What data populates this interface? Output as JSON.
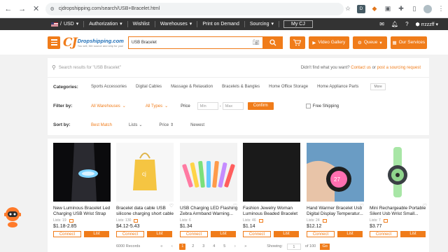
{
  "browser": {
    "url": "cjdropshipping.com/search/USB+Bracelet.html",
    "ext_badge": "D"
  },
  "topbar": {
    "currency": "USD",
    "items": [
      "Authorization",
      "Wishlist",
      "Warehouses",
      "Print on Demand",
      "Sourcing"
    ],
    "mycj": "My CJ",
    "username": "rrzzzff"
  },
  "header": {
    "logo_name": "Dropshipping.com",
    "logo_slogan": "You sell, We source and ship for you!",
    "search_value": "USB Bracelet",
    "video_gallery": "Video Gallery",
    "queue": "Queue",
    "our_services": "Our Services",
    "cart_count": "0"
  },
  "search_result": {
    "placeholder": "Search results for \"USB Bracelet\"",
    "hint_prefix": "Didn't find what you want?",
    "contact_us": "Contact us",
    "or": "or",
    "post_sourcing": "post a sourcing request"
  },
  "categories": {
    "label": "Categories:",
    "items": [
      "Sports Accessories",
      "Digital Cables",
      "Massage & Relaxation",
      "Bracelets & Bangles",
      "Home Office Storage",
      "Home Appliance Parts"
    ],
    "more": "More"
  },
  "filter": {
    "label": "Filter by:",
    "warehouses": "All Warehouses",
    "types": "All Types",
    "price_label": "Price",
    "min_placeholder": "Min",
    "max_placeholder": "Max",
    "confirm": "Confirm",
    "free_shipping": "Free Shipping"
  },
  "sort": {
    "label": "Sort by:",
    "items": [
      "Best Match",
      "Lists",
      "Price",
      "Newest"
    ]
  },
  "products": [
    {
      "title": "New Luminous Bracelet Led Charging USB Wrist Strap",
      "lists": "Lists: 19",
      "price": "$1.18-2.85"
    },
    {
      "title": "Bracelet data cable USB silicone charging short cable",
      "lists": "Lists: 130",
      "price": "$4.12-5.43"
    },
    {
      "title": "USB Charging LED Flashing Zebra Armband Warning...",
      "lists": "Lists: 6",
      "price": "$1.34"
    },
    {
      "title": "Fashion Jewelry Woman Luminous Beaded Bracelet",
      "lists": "Lists: 46",
      "price": "$1.14"
    },
    {
      "title": "Hand Warmer Bracelet Usb Digital Display Temperatur...",
      "lists": "Lists: 24",
      "price": "$12.12"
    },
    {
      "title": "Mini Rechargeable Portable Silent Usb Wrist Small...",
      "lists": "Lists: 7",
      "price": "$3.77"
    }
  ],
  "product_buttons": {
    "connect": "Connect",
    "list": "List"
  },
  "pager": {
    "records": "6000 Records",
    "pages": [
      "1",
      "2",
      "3",
      "4",
      "5"
    ],
    "showing": "Showing:",
    "input": "1",
    "of": "of 100",
    "go": "Go"
  },
  "colors": {
    "accent": "#f07c1a",
    "topbar": "#333333"
  }
}
